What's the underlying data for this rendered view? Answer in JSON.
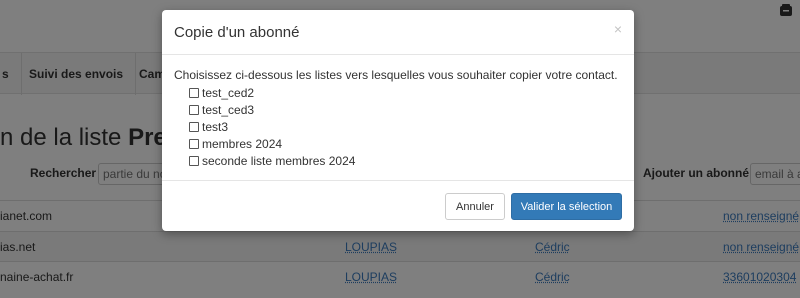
{
  "nav": {
    "items": [
      "s",
      "Suivi des envois",
      "Cam"
    ]
  },
  "page": {
    "title_prefix": "n de la liste ",
    "title_bold": "Pres"
  },
  "search": {
    "label": "Rechercher",
    "placeholder": "partie du no"
  },
  "add_subscriber": {
    "label": "Ajouter un abonné",
    "placeholder": "email à aj"
  },
  "rows": [
    {
      "email": "ianet.com",
      "lname": "",
      "fname": "",
      "phone": "non renseigné"
    },
    {
      "email": "ias.net",
      "lname": "LOUPIAS",
      "fname": "Cédric",
      "phone": "non renseigné"
    },
    {
      "email": "naine-achat.fr",
      "lname": "LOUPIAS",
      "fname": "Cédric",
      "phone": "33601020304"
    }
  ],
  "modal": {
    "title": "Copie d'un abonné",
    "close": "×",
    "instruction": "Choisissez ci-dessous les listes vers lesquelles vous souhaiter copier votre contact.",
    "lists": [
      {
        "label": "test_ced2",
        "checked": false
      },
      {
        "label": "test_ced3",
        "checked": false
      },
      {
        "label": "test3",
        "checked": false
      },
      {
        "label": "membres 2024",
        "checked": false
      },
      {
        "label": "seconde liste membres 2024",
        "checked": false
      }
    ],
    "cancel_label": "Annuler",
    "confirm_label": "Valider la sélection"
  },
  "colors": {
    "primary": "#337ab7",
    "link": "#3b7bbf",
    "overlay": "rgba(0,0,0,0.5)"
  },
  "icons": {
    "top_right": "mail-box-icon"
  }
}
